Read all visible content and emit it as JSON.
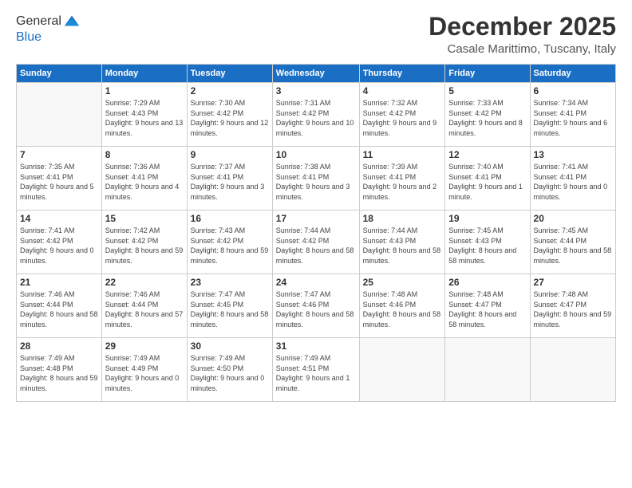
{
  "header": {
    "logo": {
      "general": "General",
      "blue": "Blue"
    },
    "title": "December 2025",
    "location": "Casale Marittimo, Tuscany, Italy"
  },
  "calendar": {
    "days_of_week": [
      "Sunday",
      "Monday",
      "Tuesday",
      "Wednesday",
      "Thursday",
      "Friday",
      "Saturday"
    ],
    "weeks": [
      [
        {
          "day": "",
          "empty": true
        },
        {
          "day": "1",
          "sunrise": "Sunrise: 7:29 AM",
          "sunset": "Sunset: 4:43 PM",
          "daylight": "Daylight: 9 hours and 13 minutes."
        },
        {
          "day": "2",
          "sunrise": "Sunrise: 7:30 AM",
          "sunset": "Sunset: 4:42 PM",
          "daylight": "Daylight: 9 hours and 12 minutes."
        },
        {
          "day": "3",
          "sunrise": "Sunrise: 7:31 AM",
          "sunset": "Sunset: 4:42 PM",
          "daylight": "Daylight: 9 hours and 10 minutes."
        },
        {
          "day": "4",
          "sunrise": "Sunrise: 7:32 AM",
          "sunset": "Sunset: 4:42 PM",
          "daylight": "Daylight: 9 hours and 9 minutes."
        },
        {
          "day": "5",
          "sunrise": "Sunrise: 7:33 AM",
          "sunset": "Sunset: 4:42 PM",
          "daylight": "Daylight: 9 hours and 8 minutes."
        },
        {
          "day": "6",
          "sunrise": "Sunrise: 7:34 AM",
          "sunset": "Sunset: 4:41 PM",
          "daylight": "Daylight: 9 hours and 6 minutes."
        }
      ],
      [
        {
          "day": "7",
          "sunrise": "Sunrise: 7:35 AM",
          "sunset": "Sunset: 4:41 PM",
          "daylight": "Daylight: 9 hours and 5 minutes."
        },
        {
          "day": "8",
          "sunrise": "Sunrise: 7:36 AM",
          "sunset": "Sunset: 4:41 PM",
          "daylight": "Daylight: 9 hours and 4 minutes."
        },
        {
          "day": "9",
          "sunrise": "Sunrise: 7:37 AM",
          "sunset": "Sunset: 4:41 PM",
          "daylight": "Daylight: 9 hours and 3 minutes."
        },
        {
          "day": "10",
          "sunrise": "Sunrise: 7:38 AM",
          "sunset": "Sunset: 4:41 PM",
          "daylight": "Daylight: 9 hours and 3 minutes."
        },
        {
          "day": "11",
          "sunrise": "Sunrise: 7:39 AM",
          "sunset": "Sunset: 4:41 PM",
          "daylight": "Daylight: 9 hours and 2 minutes."
        },
        {
          "day": "12",
          "sunrise": "Sunrise: 7:40 AM",
          "sunset": "Sunset: 4:41 PM",
          "daylight": "Daylight: 9 hours and 1 minute."
        },
        {
          "day": "13",
          "sunrise": "Sunrise: 7:41 AM",
          "sunset": "Sunset: 4:41 PM",
          "daylight": "Daylight: 9 hours and 0 minutes."
        }
      ],
      [
        {
          "day": "14",
          "sunrise": "Sunrise: 7:41 AM",
          "sunset": "Sunset: 4:42 PM",
          "daylight": "Daylight: 9 hours and 0 minutes."
        },
        {
          "day": "15",
          "sunrise": "Sunrise: 7:42 AM",
          "sunset": "Sunset: 4:42 PM",
          "daylight": "Daylight: 8 hours and 59 minutes."
        },
        {
          "day": "16",
          "sunrise": "Sunrise: 7:43 AM",
          "sunset": "Sunset: 4:42 PM",
          "daylight": "Daylight: 8 hours and 59 minutes."
        },
        {
          "day": "17",
          "sunrise": "Sunrise: 7:44 AM",
          "sunset": "Sunset: 4:42 PM",
          "daylight": "Daylight: 8 hours and 58 minutes."
        },
        {
          "day": "18",
          "sunrise": "Sunrise: 7:44 AM",
          "sunset": "Sunset: 4:43 PM",
          "daylight": "Daylight: 8 hours and 58 minutes."
        },
        {
          "day": "19",
          "sunrise": "Sunrise: 7:45 AM",
          "sunset": "Sunset: 4:43 PM",
          "daylight": "Daylight: 8 hours and 58 minutes."
        },
        {
          "day": "20",
          "sunrise": "Sunrise: 7:45 AM",
          "sunset": "Sunset: 4:44 PM",
          "daylight": "Daylight: 8 hours and 58 minutes."
        }
      ],
      [
        {
          "day": "21",
          "sunrise": "Sunrise: 7:46 AM",
          "sunset": "Sunset: 4:44 PM",
          "daylight": "Daylight: 8 hours and 58 minutes."
        },
        {
          "day": "22",
          "sunrise": "Sunrise: 7:46 AM",
          "sunset": "Sunset: 4:44 PM",
          "daylight": "Daylight: 8 hours and 57 minutes."
        },
        {
          "day": "23",
          "sunrise": "Sunrise: 7:47 AM",
          "sunset": "Sunset: 4:45 PM",
          "daylight": "Daylight: 8 hours and 58 minutes."
        },
        {
          "day": "24",
          "sunrise": "Sunrise: 7:47 AM",
          "sunset": "Sunset: 4:46 PM",
          "daylight": "Daylight: 8 hours and 58 minutes."
        },
        {
          "day": "25",
          "sunrise": "Sunrise: 7:48 AM",
          "sunset": "Sunset: 4:46 PM",
          "daylight": "Daylight: 8 hours and 58 minutes."
        },
        {
          "day": "26",
          "sunrise": "Sunrise: 7:48 AM",
          "sunset": "Sunset: 4:47 PM",
          "daylight": "Daylight: 8 hours and 58 minutes."
        },
        {
          "day": "27",
          "sunrise": "Sunrise: 7:48 AM",
          "sunset": "Sunset: 4:47 PM",
          "daylight": "Daylight: 8 hours and 59 minutes."
        }
      ],
      [
        {
          "day": "28",
          "sunrise": "Sunrise: 7:49 AM",
          "sunset": "Sunset: 4:48 PM",
          "daylight": "Daylight: 8 hours and 59 minutes."
        },
        {
          "day": "29",
          "sunrise": "Sunrise: 7:49 AM",
          "sunset": "Sunset: 4:49 PM",
          "daylight": "Daylight: 9 hours and 0 minutes."
        },
        {
          "day": "30",
          "sunrise": "Sunrise: 7:49 AM",
          "sunset": "Sunset: 4:50 PM",
          "daylight": "Daylight: 9 hours and 0 minutes."
        },
        {
          "day": "31",
          "sunrise": "Sunrise: 7:49 AM",
          "sunset": "Sunset: 4:51 PM",
          "daylight": "Daylight: 9 hours and 1 minute."
        },
        {
          "day": "",
          "empty": true
        },
        {
          "day": "",
          "empty": true
        },
        {
          "day": "",
          "empty": true
        }
      ]
    ]
  }
}
